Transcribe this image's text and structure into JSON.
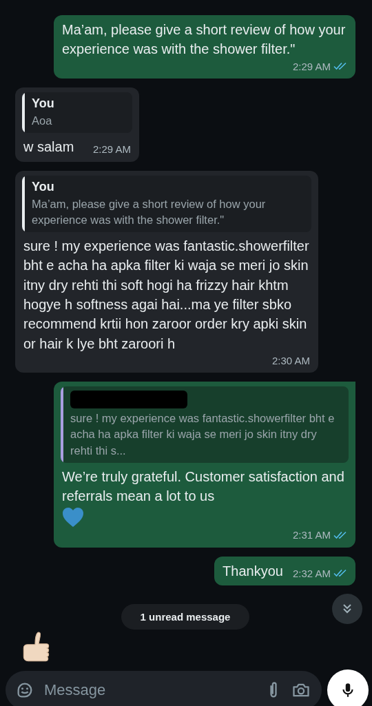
{
  "messages": [
    {
      "kind": "outgoing",
      "text": "Ma’am, please give a short review of how your experience was with the shower filter.\"",
      "time": "2:29 AM",
      "read": true
    },
    {
      "kind": "incoming",
      "quote": {
        "author": "You",
        "text": "Aoa"
      },
      "text": "w salam",
      "time": "2:29 AM"
    },
    {
      "kind": "incoming",
      "quote": {
        "author": "You",
        "text": "Ma’am, please give a short review of how your experience was with the shower filter.\""
      },
      "text": "sure ! my experience was fantastic.showerfilter bht e acha ha apka filter ki waja se meri jo skin itny dry rehti thi soft hogi ha frizzy hair khtm hogye h softness agai hai...ma ye filter sbko recommend krtii hon zaroor order kry apki skin or hair k lye bht zaroori h",
      "time": "2:30 AM"
    },
    {
      "kind": "outgoing",
      "tail": true,
      "quote": {
        "author_redacted": true,
        "text": "sure ! my experience was fantastic.showerfilter bht e acha ha apka filter ki waja se meri jo skin itny dry rehti thi s..."
      },
      "text": "We’re truly grateful. Customer satisfaction and referrals mean a lot to us",
      "heart_emoji": true,
      "time": "2:31 AM",
      "read": true
    },
    {
      "kind": "outgoing",
      "text": "Thankyou",
      "time": "2:32 AM",
      "read": true
    }
  ],
  "unread_banner": "1 unread message",
  "composer": {
    "placeholder": "Message"
  }
}
